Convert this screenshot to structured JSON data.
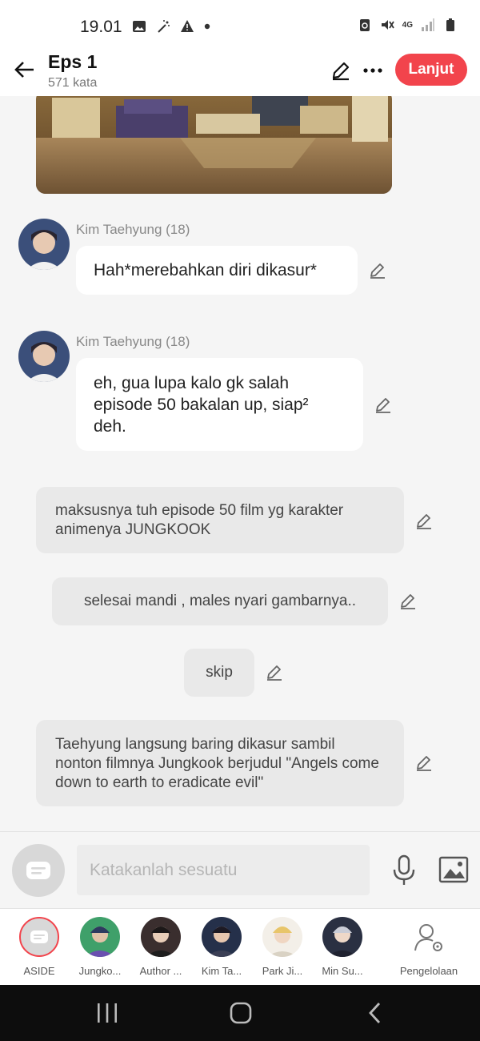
{
  "status_bar": {
    "time": "19.01",
    "network": "4G"
  },
  "header": {
    "title": "Eps 1",
    "subtitle": "571 kata",
    "continue_label": "Lanjut"
  },
  "messages": [
    {
      "speaker": "Kim Taehyung (18)",
      "text": "Hah*merebahkan diri dikasur*"
    },
    {
      "speaker": "Kim Taehyung (18)",
      "text": "eh, gua lupa kalo gk salah episode 50 bakalan up, siap² deh."
    }
  ],
  "narrations": [
    "maksusnya tuh episode 50 film yg karakter animenya JUNGKOOK",
    "selesai mandi , males nyari gambarnya..",
    "skip",
    "Taehyung langsung baring dikasur sambil nonton filmnya Jungkook berjudul \"Angels come down to earth to eradicate evil\""
  ],
  "input": {
    "placeholder": "Katakanlah sesuatu"
  },
  "characters": [
    {
      "label": "ASIDE"
    },
    {
      "label": "Jungko..."
    },
    {
      "label": "Author ..."
    },
    {
      "label": "Kim Ta..."
    },
    {
      "label": "Park Ji..."
    },
    {
      "label": "Min Su..."
    },
    {
      "label": "Pengelolaan"
    }
  ],
  "colors": {
    "accent": "#f2444c",
    "bubble": "#ffffff",
    "narration": "#e9e9e9",
    "background": "#f5f5f5"
  }
}
